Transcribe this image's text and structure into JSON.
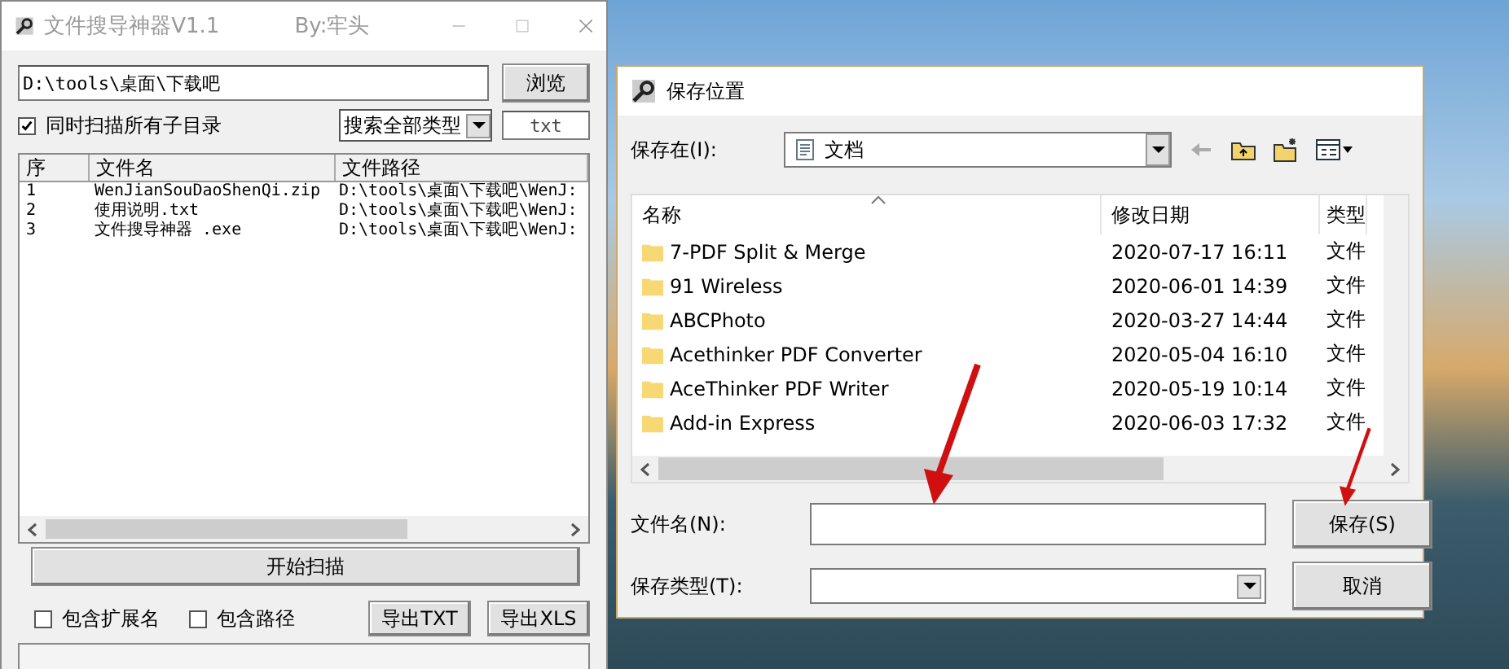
{
  "main_window": {
    "title": "文件搜导神器V1.1",
    "author": "By:牢头",
    "path": "D:\\tools\\桌面\\下载吧",
    "browse_button": "浏览",
    "subdirs": {
      "label": "同时扫描所有子目录",
      "checked": true
    },
    "type_select": "搜索全部类型",
    "extension": "txt",
    "table": {
      "columns": [
        "序",
        "文件名",
        "文件路径"
      ],
      "rows": [
        {
          "index": "1",
          "name": "WenJianSouDaoShenQi.zip",
          "path": "D:\\tools\\桌面\\下载吧\\WenJ:"
        },
        {
          "index": "2",
          "name": "使用说明.txt",
          "path": "D:\\tools\\桌面\\下载吧\\WenJ:"
        },
        {
          "index": "3",
          "name": "文件搜导神器 .exe",
          "path": "D:\\tools\\桌面\\下载吧\\WenJ:"
        }
      ]
    },
    "scan_button": "开始扫描",
    "options": [
      {
        "label": "包含扩展名",
        "checked": false
      },
      {
        "label": "包含路径",
        "checked": false
      }
    ],
    "export_buttons": [
      "导出TXT",
      "导出XLS"
    ]
  },
  "dialog": {
    "title": "保存位置",
    "save_in_label": "保存在(I):",
    "save_in_value": "文档",
    "columns": [
      "名称",
      "修改日期",
      "类型"
    ],
    "rows": [
      {
        "name": "7-PDF Split & Merge",
        "date": "2020-07-17 16:11",
        "type": "文件"
      },
      {
        "name": "91 Wireless",
        "date": "2020-06-01 14:39",
        "type": "文件"
      },
      {
        "name": "ABCPhoto",
        "date": "2020-03-27 14:44",
        "type": "文件"
      },
      {
        "name": "Acethinker PDF Converter",
        "date": "2020-05-04 16:10",
        "type": "文件"
      },
      {
        "name": "AceThinker PDF Writer",
        "date": "2020-05-19 10:14",
        "type": "文件"
      },
      {
        "name": "Add-in Express",
        "date": "2020-06-03 17:32",
        "type": "文件"
      }
    ],
    "filename_label": "文件名(N):",
    "filetype_label": "保存类型(T):",
    "save_button": "保存(S)",
    "cancel_button": "取消"
  }
}
